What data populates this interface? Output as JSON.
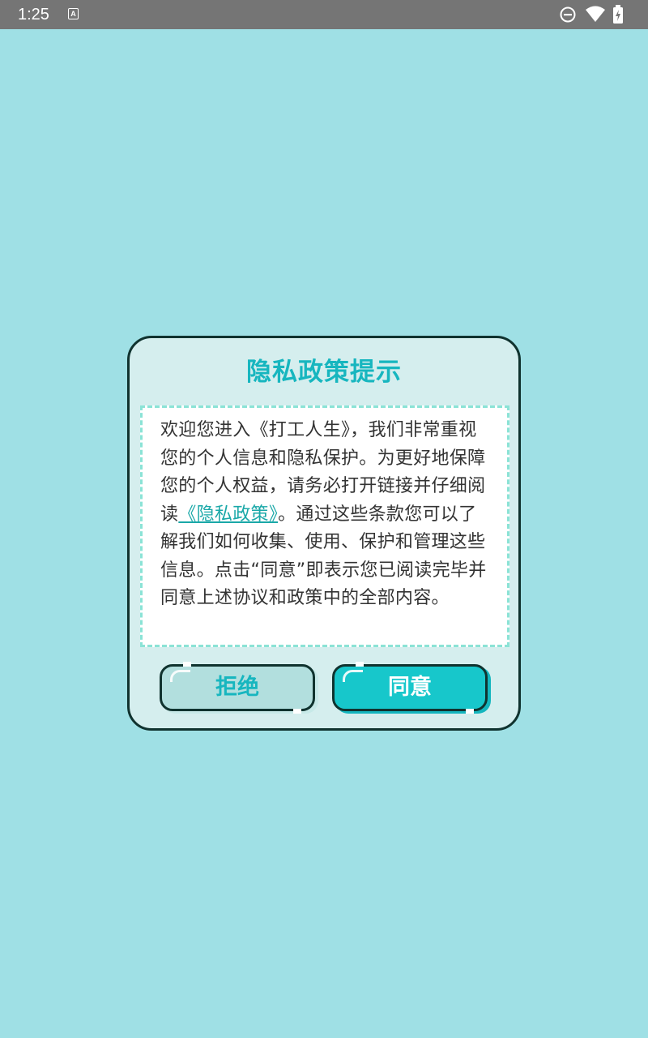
{
  "status_bar": {
    "time": "1:25",
    "notification_icon": "a-text-icon",
    "right_icons": [
      "do-not-disturb-icon",
      "wifi-icon",
      "battery-icon"
    ]
  },
  "dialog": {
    "title": "隐私政策提示",
    "content_before_link": "欢迎您进入《打工人生》，我们非常重视您的个人信息和隐私保护。为更好地保障您的个人权益，请务必打开链接并仔细阅读",
    "policy_link": "《隐私政策》",
    "content_after_link": "。通过这些条款您可以了解我们如何收集、使用、保护和管理这些信息。点击“同意”即表示您已阅读完毕并同意上述协议和政策中的全部内容。",
    "reject_label": "拒绝",
    "agree_label": "同意"
  },
  "colors": {
    "background": "#9FE0E5",
    "status_bar": "#757575",
    "dialog_bg": "#D5EEEE",
    "accent": "#17B6BF",
    "agree_button": "#17C7CB",
    "reject_button": "#B2DFDE",
    "border": "#10332F"
  }
}
